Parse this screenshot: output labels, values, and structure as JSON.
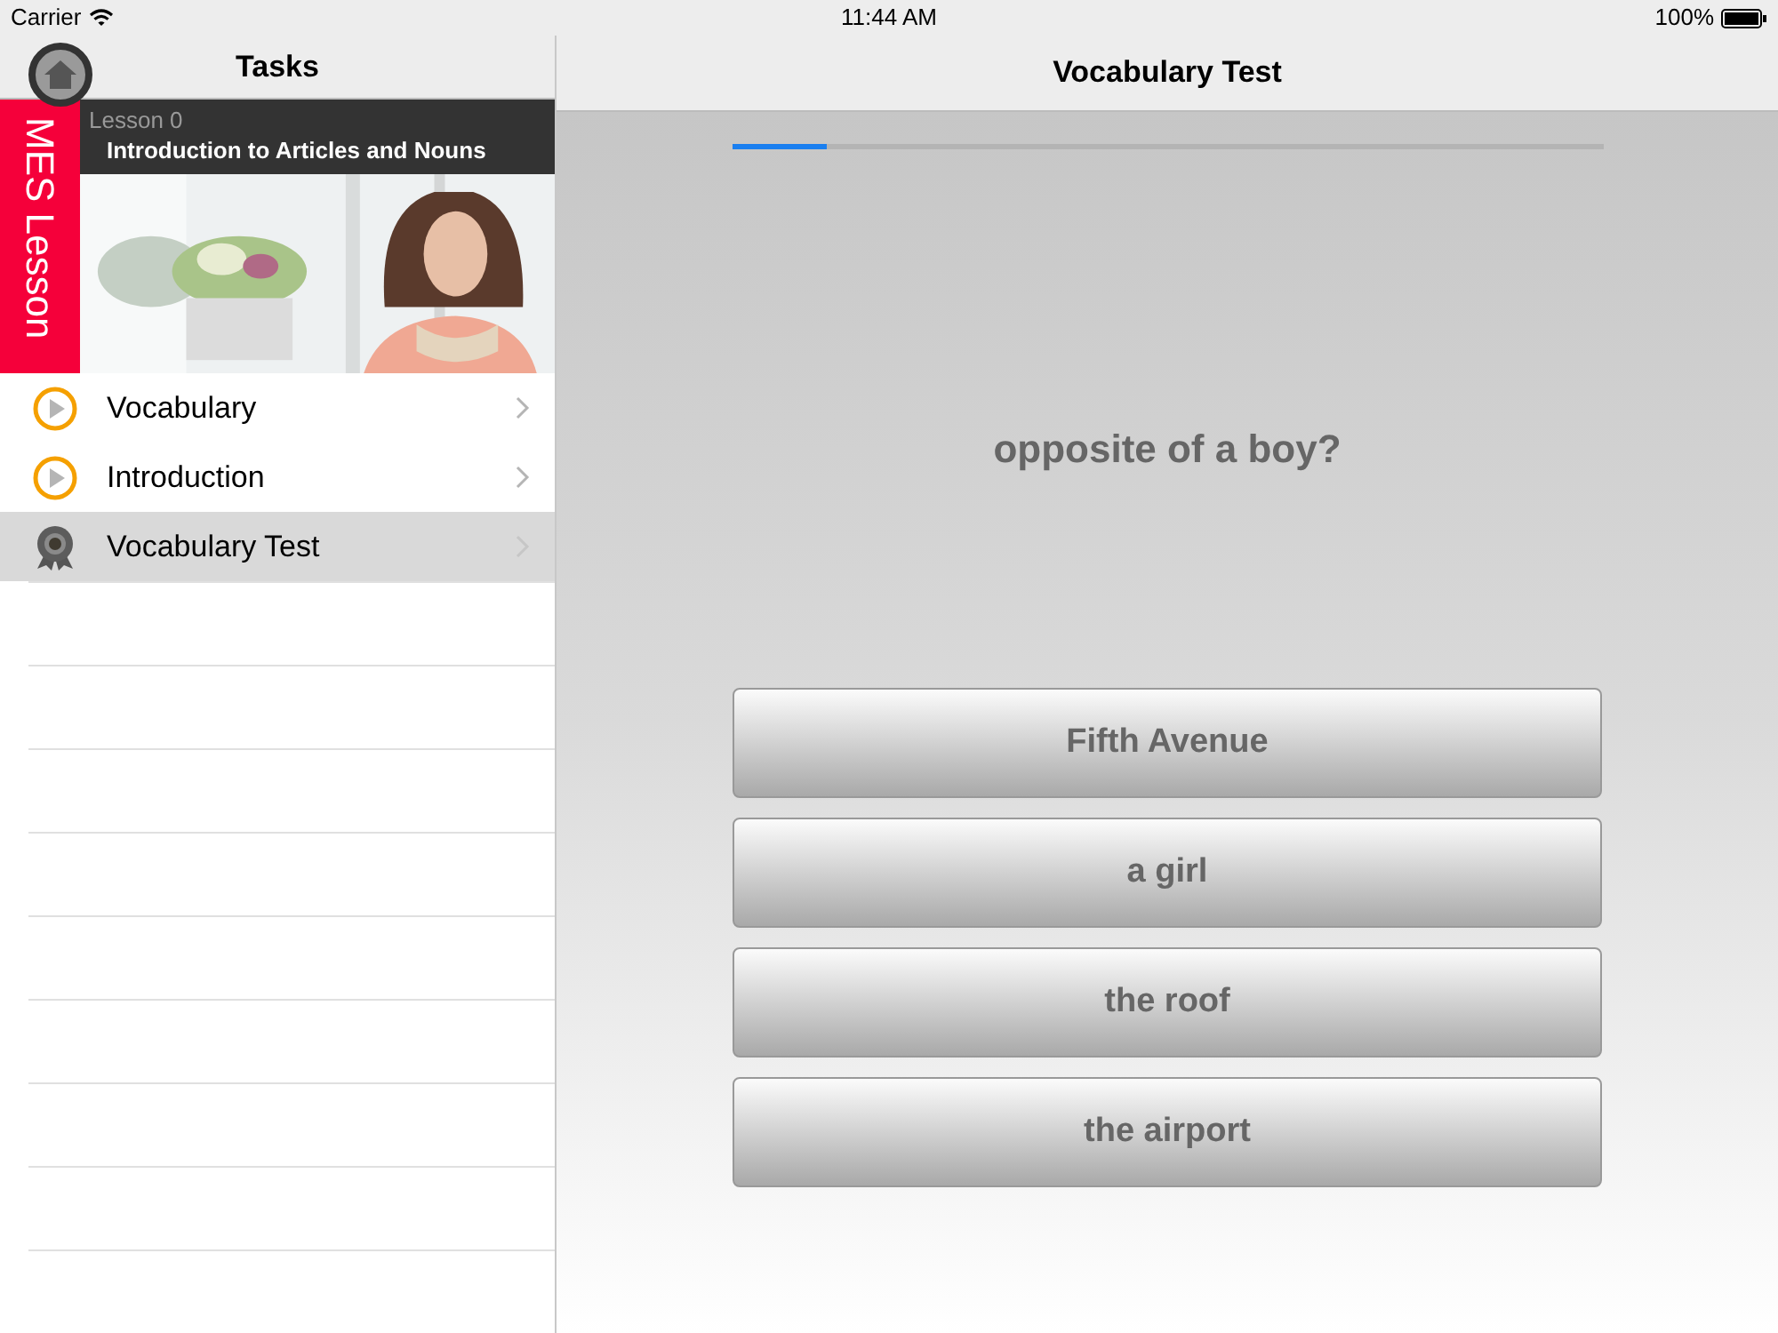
{
  "status_bar": {
    "carrier": "Carrier",
    "time": "11:44 AM",
    "battery": "100%"
  },
  "sidebar": {
    "title": "Tasks",
    "banner": {
      "brand": "MES Lesson",
      "lesson": "Lesson 0",
      "title": "Introduction to Articles and Nouns"
    },
    "items": [
      {
        "label": "Vocabulary",
        "kind": "play",
        "selected": false
      },
      {
        "label": "Introduction",
        "kind": "play",
        "selected": false
      },
      {
        "label": "Vocabulary Test",
        "kind": "medal",
        "selected": true
      }
    ]
  },
  "quiz": {
    "title": "Vocabulary Test",
    "progress": {
      "level": 0.11
    },
    "question": "opposite of a boy?",
    "answers": [
      "Fifth Avenue",
      "a girl",
      "the roof",
      "the airport"
    ]
  }
}
